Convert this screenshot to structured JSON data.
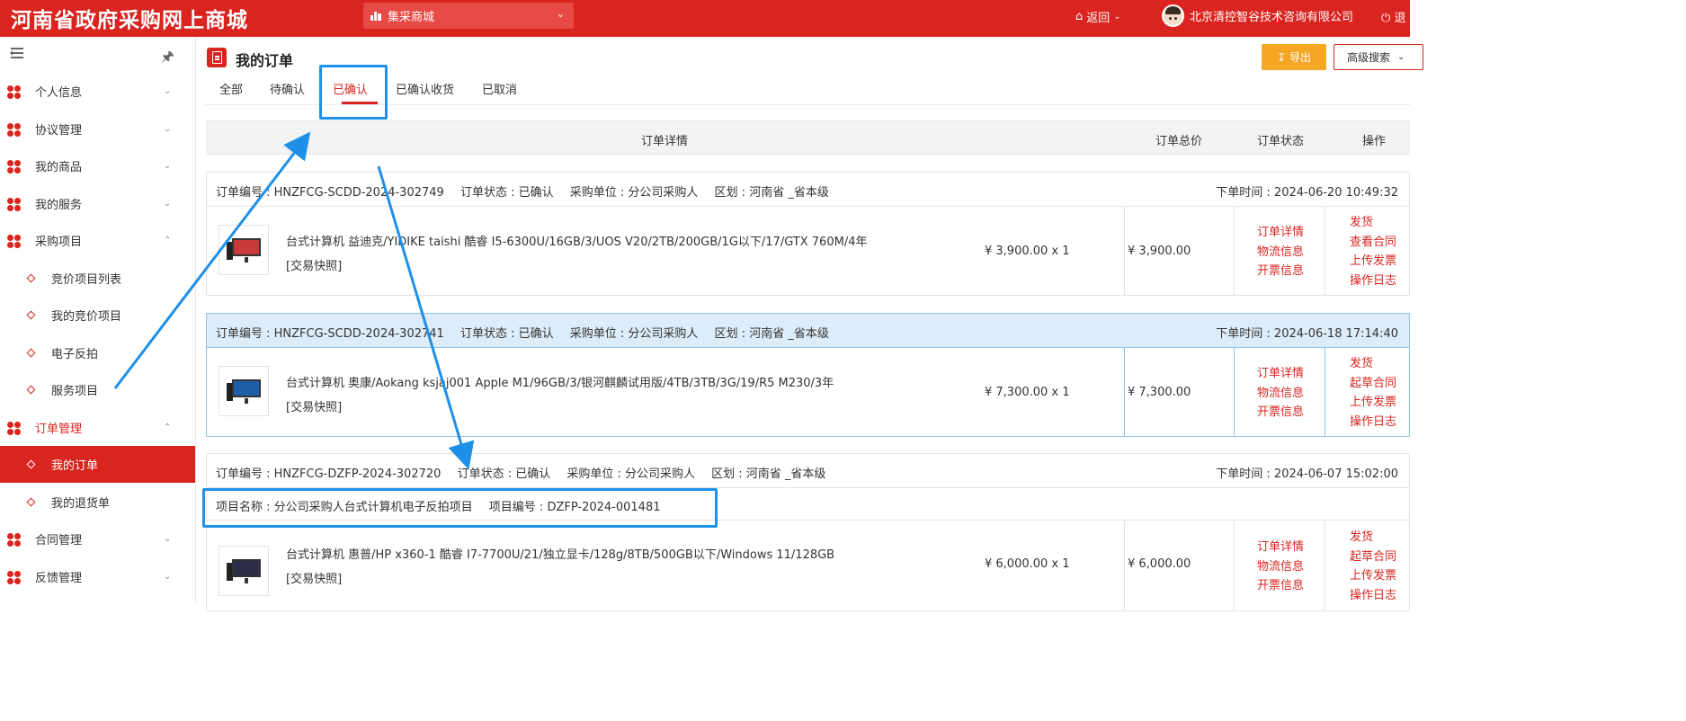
{
  "header": {
    "site_title": "河南省政府采购网上商城",
    "mall_select": "集采商城",
    "back_label": "返回",
    "company": "北京清控智谷技术咨询有限公司",
    "logout": "退"
  },
  "sidebar": {
    "items": [
      {
        "label": "个人信息",
        "icon": "clover-icon",
        "chevron": "chevron-down"
      },
      {
        "label": "协议管理",
        "icon": "clover-icon",
        "chevron": "chevron-down"
      },
      {
        "label": "我的商品",
        "icon": "clover-icon",
        "chevron": "chevron-down"
      },
      {
        "label": "我的服务",
        "icon": "clover-icon",
        "chevron": "chevron-down"
      },
      {
        "label": "采购项目",
        "icon": "clover-icon",
        "chevron": "chevron-up"
      },
      {
        "label": "竞价项目列表",
        "sub": true
      },
      {
        "label": "我的竞价项目",
        "sub": true
      },
      {
        "label": "电子反拍",
        "sub": true
      },
      {
        "label": "服务项目",
        "sub": true
      },
      {
        "label": "订单管理",
        "icon": "clover-icon",
        "chevron": "chevron-up",
        "open": true
      },
      {
        "label": "我的订单",
        "sub": true,
        "active": true
      },
      {
        "label": "我的退货单",
        "sub": true
      },
      {
        "label": "合同管理",
        "icon": "clover-icon",
        "chevron": "chevron-down"
      },
      {
        "label": "反馈管理",
        "icon": "clover-icon",
        "chevron": "chevron-down"
      }
    ]
  },
  "page": {
    "title": "我的订单",
    "export_label": "导出",
    "advanced_search": "高级搜索"
  },
  "tabs": [
    "全部",
    "待确认",
    "已确认",
    "已确认收货",
    "已取消"
  ],
  "active_tab": "已确认",
  "table_header": {
    "detail": "订单详情",
    "total": "订单总价",
    "status": "订单状态",
    "ops": "操作"
  },
  "orders": [
    {
      "order_no": "订单编号 : HNZFCG-SCDD-2024-302749",
      "status": "订单状态 : 已确认",
      "unit": "采购单位 : 分公司采购人",
      "region": "区划 : 河南省 _省本级",
      "time": "下单时间 : 2024-06-20 10:49:32",
      "product": "台式计算机 益迪克/YIDIKE taishi 酷睿 I5-6300U/16GB/3/UOS V20/2TB/200GB/1G以下/17/GTX 760M/4年",
      "snapshot": "[交易快照]",
      "unit_price": "¥ 3,900.00 x 1",
      "total": "¥  3,900.00",
      "links": [
        "订单详情",
        "物流信息",
        "开票信息"
      ],
      "ops": [
        "发货",
        "查看合同",
        "上传发票",
        "操作日志"
      ]
    },
    {
      "order_no": "订单编号 : HNZFCG-SCDD-2024-302741",
      "status": "订单状态 : 已确认",
      "unit": "采购单位 : 分公司采购人",
      "region": "区划 : 河南省 _省本级",
      "time": "下单时间 : 2024-06-18 17:14:40",
      "product": "台式计算机 奥康/Aokang ksjaj001 Apple M1/96GB/3/银河麒麟试用版/4TB/3TB/3G/19/R5 M230/3年",
      "snapshot": "[交易快照]",
      "unit_price": "¥ 7,300.00 x 1",
      "total": "¥  7,300.00",
      "links": [
        "订单详情",
        "物流信息",
        "开票信息"
      ],
      "ops": [
        "发货",
        "起草合同",
        "上传发票",
        "操作日志"
      ]
    },
    {
      "order_no": "订单编号 : HNZFCG-DZFP-2024-302720",
      "status": "订单状态 : 已确认",
      "unit": "采购单位 : 分公司采购人",
      "region": "区划 : 河南省 _省本级",
      "time": "下单时间 : 2024-06-07 15:02:00",
      "project_name": "项目名称 : 分公司采购人台式计算机电子反拍项目",
      "project_no": "项目编号 : DZFP-2024-001481",
      "product": "台式计算机 惠普/HP x360-1 酷睿 I7-7700U/21/独立显卡/128g/8TB/500GB以下/Windows 11/128GB",
      "snapshot": "[交易快照]",
      "unit_price": "¥ 6,000.00 x 1",
      "total": "¥  6,000.00",
      "links": [
        "订单详情",
        "物流信息",
        "开票信息"
      ],
      "ops": [
        "发货",
        "起草合同",
        "上传发票",
        "操作日志"
      ]
    }
  ],
  "colors": {
    "brand_red": "#d9241f",
    "export_orange": "#f5a623",
    "annotation_blue": "#1e90e8",
    "highlight_row": "#dcecf8"
  }
}
